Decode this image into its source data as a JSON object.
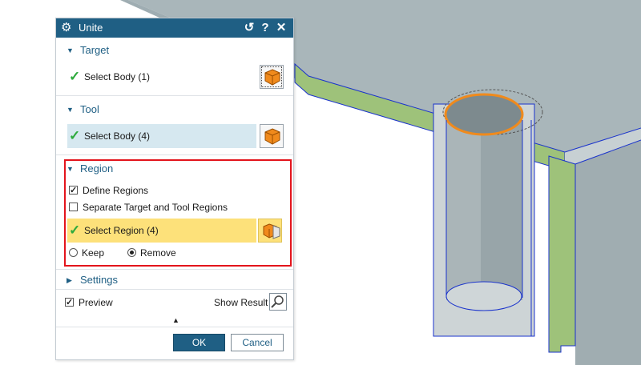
{
  "dialog": {
    "title": "Unite",
    "icon": "gear-icon",
    "titlebar_buttons": {
      "reset": "↺",
      "help": "?",
      "close": "✕"
    },
    "sections": {
      "target": {
        "label": "Target",
        "select_label": "Select Body (1)"
      },
      "tool": {
        "label": "Tool",
        "select_label": "Select Body (4)"
      },
      "region": {
        "label": "Region",
        "define_regions": {
          "label": "Define Regions",
          "checked": true
        },
        "separate_regions": {
          "label": "Separate Target and Tool Regions",
          "checked": false
        },
        "select_label": "Select Region (4)",
        "radio_keep": {
          "label": "Keep",
          "selected": false
        },
        "radio_remove": {
          "label": "Remove",
          "selected": true
        }
      },
      "settings": {
        "label": "Settings"
      }
    },
    "preview": {
      "label": "Preview",
      "checked": true
    },
    "show_result_label": "Show Result",
    "ok_label": "OK",
    "cancel_label": "Cancel"
  },
  "colors": {
    "titlebar": "#1f5f84",
    "section_text": "#1f5f84",
    "check_green": "#2eaa3d",
    "tool_row_bg": "#d6e8f0",
    "region_row_bg": "#fde17a",
    "highlight_red": "#e3141c",
    "model_gray": "#a7b4b8",
    "model_green": "#9ec27a",
    "edge_blue": "#1a33cc",
    "body_orange": "#f08a1c"
  }
}
